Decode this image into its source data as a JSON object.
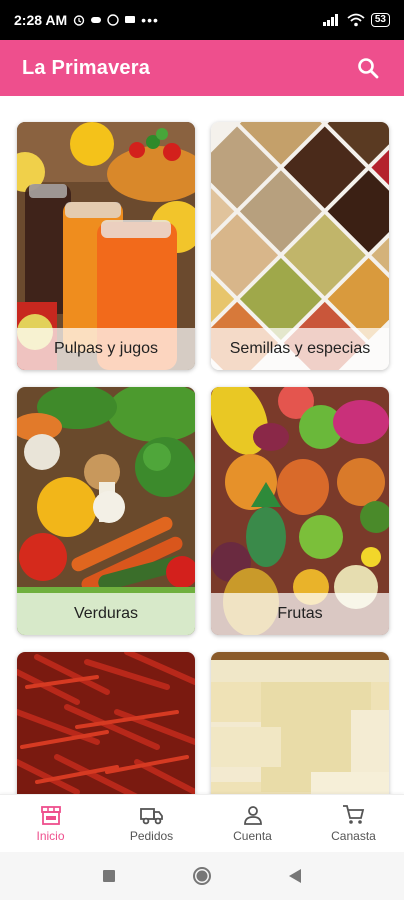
{
  "status_bar": {
    "time": "2:28 AM",
    "battery": "53"
  },
  "app_bar": {
    "title": "La Primavera",
    "search_icon": "search-icon"
  },
  "categories": [
    {
      "label": "Pulpas y jugos",
      "image": "juices-photo"
    },
    {
      "label": "Semillas y especias",
      "image": "seeds-spices-photo"
    },
    {
      "label": "Verduras",
      "image": "vegetables-photo"
    },
    {
      "label": "Frutas",
      "image": "fruits-photo"
    },
    {
      "label": "",
      "image": "dried-chili-photo"
    },
    {
      "label": "",
      "image": "cheese-photo"
    }
  ],
  "bottom_nav": [
    {
      "label": "Inicio",
      "icon": "store-icon",
      "active": true
    },
    {
      "label": "Pedidos",
      "icon": "truck-icon",
      "active": false
    },
    {
      "label": "Cuenta",
      "icon": "person-icon",
      "active": false
    },
    {
      "label": "Canasta",
      "icon": "cart-icon",
      "active": false
    }
  ],
  "colors": {
    "primary": "#ee4f8d",
    "status_bar": "#000000"
  }
}
